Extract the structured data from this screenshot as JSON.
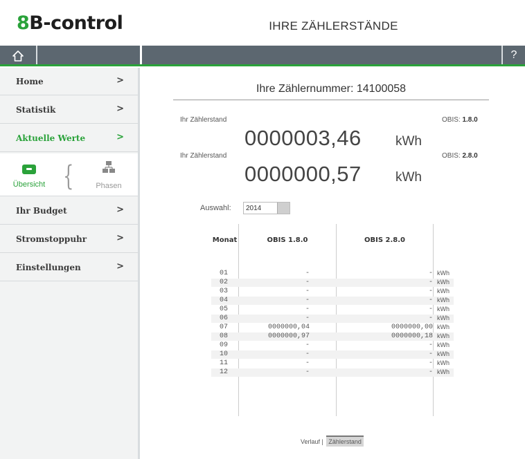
{
  "header": {
    "logo_accent": "8",
    "logo_rest": "B-control",
    "title": "IHRE ZÄHLERSTÄNDE",
    "home_icon": "home-icon",
    "help_label": "?"
  },
  "colors": {
    "accent": "#2aa23a",
    "navbar": "#5c6770",
    "sidebar": "#f2f3f3"
  },
  "sidebar": {
    "items": [
      {
        "label": "Home",
        "chevron": ">"
      },
      {
        "label": "Statistik",
        "chevron": ">"
      },
      {
        "label": "Aktuelle Werte",
        "chevron": ">"
      },
      {
        "label": "Ihr Budget",
        "chevron": ">"
      },
      {
        "label": "Stromstoppuhr",
        "chevron": ">"
      },
      {
        "label": "Einstellungen",
        "chevron": ">"
      }
    ],
    "sub": {
      "overview": "Übersicht",
      "phases": "Phasen"
    }
  },
  "main": {
    "meter_title": "Ihre Zählernummer: 14100058",
    "reading1": {
      "label": "Ihr Zählerstand",
      "value": "0000003,46",
      "unit": "kWh",
      "obis_prefix": "OBIS:",
      "obis_code": "1.8.0"
    },
    "reading2": {
      "label": "Ihr Zählerstand",
      "value": "0000000,57",
      "unit": "kWh",
      "obis_prefix": "OBIS:",
      "obis_code": "2.8.0"
    },
    "select_label": "Auswahl:",
    "select_value": "2014",
    "table": {
      "headers": [
        "Monat",
        "OBIS 1.8.0",
        "OBIS 2.8.0"
      ],
      "rows": [
        [
          "01",
          "-",
          "-",
          "kWh"
        ],
        [
          "02",
          "-",
          "-",
          "kWh"
        ],
        [
          "03",
          "-",
          "-",
          "kWh"
        ],
        [
          "04",
          "-",
          "-",
          "kWh"
        ],
        [
          "05",
          "-",
          "-",
          "kWh"
        ],
        [
          "06",
          "-",
          "-",
          "kWh"
        ],
        [
          "07",
          "0000000,04",
          "0000000,00",
          "kWh"
        ],
        [
          "08",
          "0000000,97",
          "0000000,18",
          "kWh"
        ],
        [
          "09",
          "-",
          "-",
          "kWh"
        ],
        [
          "10",
          "-",
          "-",
          "kWh"
        ],
        [
          "11",
          "-",
          "-",
          "kWh"
        ],
        [
          "12",
          "-",
          "-",
          "kWh"
        ]
      ]
    },
    "footer": {
      "verlauf": "Verlauf",
      "separator": "|",
      "zaehlerstand": "Zählerstand"
    }
  }
}
